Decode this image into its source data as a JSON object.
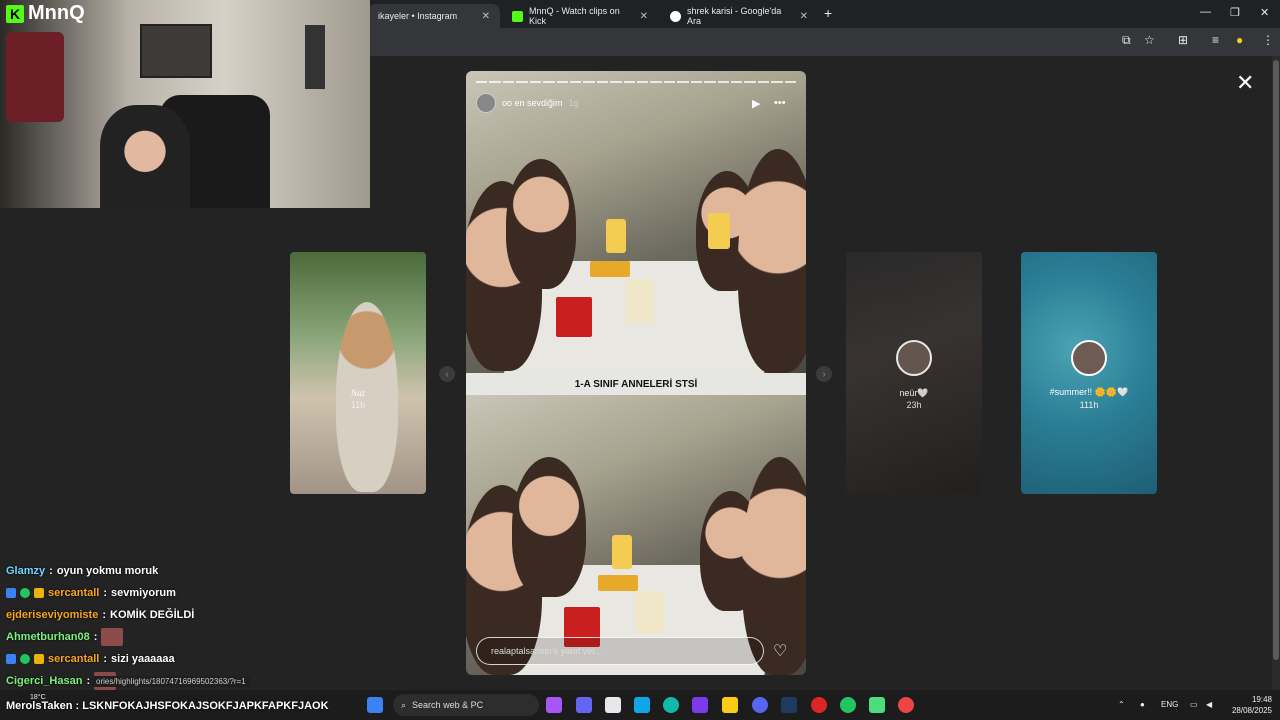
{
  "browser": {
    "tabs": [
      {
        "label": "ikayeler • Instagram",
        "active": true
      },
      {
        "label": "MnnQ - Watch clips on Kick",
        "active": false
      },
      {
        "label": "shrek karisi - Google'da Ara",
        "active": false
      }
    ],
    "close_glyph": "✕",
    "newtab_glyph": "+",
    "window_controls": [
      "—",
      "❐",
      "✕"
    ]
  },
  "story": {
    "username": "oo en sevdiğim",
    "time": "1g",
    "caption": "1-A SINIF ANNELERİ STSİ",
    "reply_placeholder": "realaptalsarisin'e yanıt ver...",
    "close_glyph": "✕",
    "play_glyph": "▶",
    "more_glyph": "•••",
    "heart_glyph": "♡"
  },
  "side_stories": [
    {
      "name": "Naz",
      "time": "11h"
    },
    {
      "name": "neür🤍",
      "time": "23h"
    },
    {
      "name": "#summer!! 🌼🌼🤍",
      "time": "111h"
    }
  ],
  "nav": {
    "prev": "‹",
    "next": "›"
  },
  "webcam": {
    "brand": "MnnQ",
    "brand_icon": "K"
  },
  "chat": [
    {
      "user": "Glamzy",
      "text": "oyun yokmu moruk",
      "color": "#6fd6ff",
      "badges": false,
      "emote": false
    },
    {
      "user": "sercantall",
      "text": "sevmiyorum",
      "color": "#f7a51c",
      "badges": true,
      "emote": false
    },
    {
      "user": "ejderiseviyomiste",
      "text": "KOMİK DEĞİLDİ",
      "color": "#f7a51c",
      "badges": false,
      "emote": false
    },
    {
      "user": "Ahmetburhan08",
      "text": "",
      "color": "#7bf07b",
      "badges": false,
      "emote": true
    },
    {
      "user": "sercantall",
      "text": "sizi yaaaaaa",
      "color": "#f7a51c",
      "badges": true,
      "emote": false
    },
    {
      "user": "Cigerci_Hasan",
      "text": "",
      "color": "#7bf07b",
      "badges": false,
      "emote": true
    }
  ],
  "status_url": "ories/highlights/18074716969502363/?r=1",
  "bottom_line": {
    "user": "MerolsTaken",
    "text": "LSKNFOKAJHSFOKAJSOKFJAPKFAPKFJAOK"
  },
  "taskbar": {
    "search_placeholder": "Search web & PC",
    "weather": "18°C",
    "lang": "ENG",
    "time": "19:48",
    "date": "28/08/2025"
  },
  "colors": {
    "kick_green": "#53fc18",
    "page_bg": "#232323"
  }
}
